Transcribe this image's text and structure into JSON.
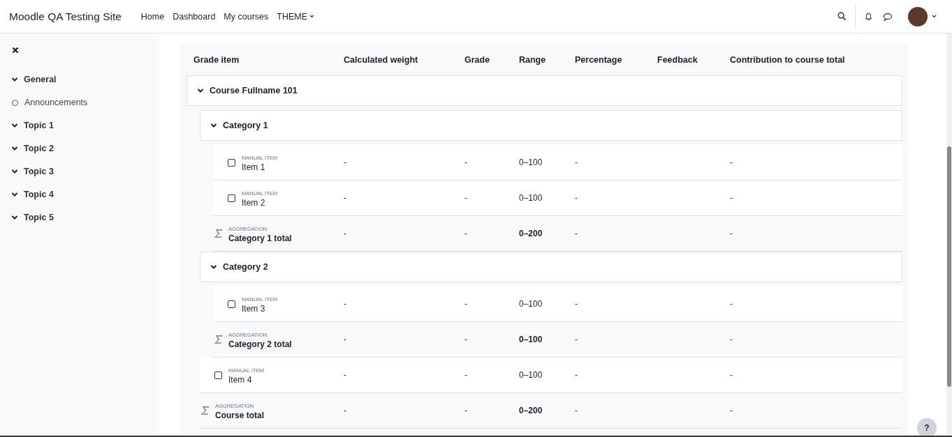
{
  "navbar": {
    "site_name": "Moodle QA Testing Site",
    "links": [
      {
        "label": "Home",
        "kind": "link"
      },
      {
        "label": "Dashboard",
        "kind": "link"
      },
      {
        "label": "My courses",
        "kind": "link"
      },
      {
        "label": "THEME",
        "kind": "dropdown"
      }
    ]
  },
  "sidebar": {
    "items": [
      {
        "label": "General",
        "kind": "section",
        "expanded": true
      },
      {
        "label": "Announcements",
        "kind": "activity"
      },
      {
        "label": "Topic 1",
        "kind": "section",
        "expanded": true
      },
      {
        "label": "Topic 2",
        "kind": "section",
        "expanded": true
      },
      {
        "label": "Topic 3",
        "kind": "section",
        "expanded": true
      },
      {
        "label": "Topic 4",
        "kind": "section",
        "expanded": true
      },
      {
        "label": "Topic 5",
        "kind": "section",
        "expanded": true
      }
    ]
  },
  "table": {
    "columns": [
      "Grade item",
      "Calculated weight",
      "Grade",
      "Range",
      "Percentage",
      "Feedback",
      "Contribution to course total"
    ],
    "rows": [
      {
        "kind": "category",
        "name": "Course Fullname 101",
        "expanded": true,
        "children": [
          {
            "kind": "category",
            "name": "Category 1",
            "expanded": true,
            "children": [
              {
                "kind": "item",
                "type_label": "MANUAL ITEM",
                "name": "Item 1",
                "checked": false,
                "weight": "-",
                "grade": "-",
                "range": "0–100",
                "percentage": "-",
                "contribution": "-"
              },
              {
                "kind": "item",
                "type_label": "MANUAL ITEM",
                "name": "Item 2",
                "checked": false,
                "weight": "-",
                "grade": "-",
                "range": "0–100",
                "percentage": "-",
                "contribution": "-"
              },
              {
                "kind": "total",
                "type_label": "AGGREGATION",
                "name": "Category 1 total",
                "weight": "-",
                "grade": "-",
                "range": "0–200",
                "percentage": "-",
                "contribution": "-"
              }
            ]
          },
          {
            "kind": "category",
            "name": "Category 2",
            "expanded": true,
            "children": [
              {
                "kind": "item",
                "type_label": "MANUAL ITEM",
                "name": "Item 3",
                "checked": false,
                "weight": "-",
                "grade": "-",
                "range": "0–100",
                "percentage": "-",
                "contribution": "-"
              },
              {
                "kind": "total",
                "type_label": "AGGREGATION",
                "name": "Category 2 total",
                "weight": "-",
                "grade": "-",
                "range": "0–100",
                "percentage": "-",
                "contribution": "-"
              }
            ]
          },
          {
            "kind": "item",
            "type_label": "MANUAL ITEM",
            "name": "Item 4",
            "checked": false,
            "weight": "-",
            "grade": "-",
            "range": "0–100",
            "percentage": "-",
            "contribution": "-"
          },
          {
            "kind": "total",
            "type_label": "AGGREGATION",
            "name": "Course total",
            "weight": "-",
            "grade": "-",
            "range": "0–200",
            "percentage": "-",
            "contribution": "-"
          }
        ]
      }
    ]
  },
  "help_button": {
    "label": "?"
  }
}
